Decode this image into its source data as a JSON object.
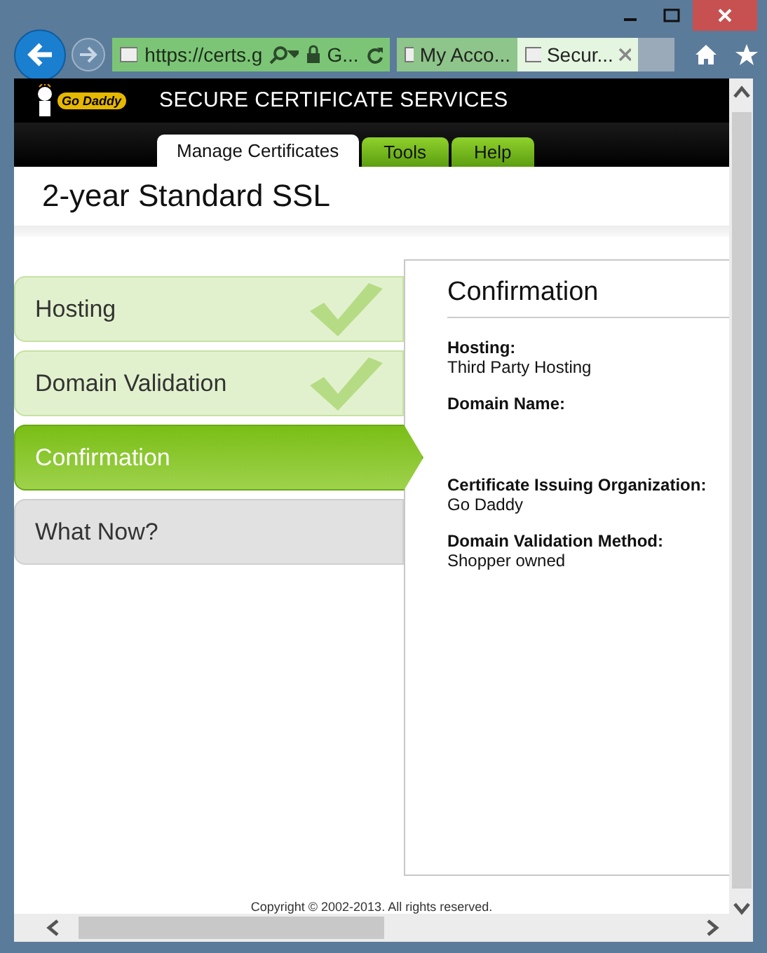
{
  "browser": {
    "address": {
      "url": "https://certs.g",
      "site": "G..."
    },
    "tabs": [
      {
        "label": "My Acco...",
        "selected": false
      },
      {
        "label": "Secur...",
        "selected": true
      }
    ]
  },
  "header": {
    "logo": "Go Daddy",
    "title": "SECURE CERTIFICATE SERVICES"
  },
  "nav_tabs": [
    {
      "label": "Manage Certificates",
      "selected": true
    },
    {
      "label": "Tools",
      "selected": false
    },
    {
      "label": "Help",
      "selected": false
    }
  ],
  "page_title": "2-year Standard SSL",
  "steps": [
    {
      "label": "Hosting",
      "completed": true,
      "selected": false
    },
    {
      "label": "Domain Validation",
      "completed": true,
      "selected": false
    },
    {
      "label": "Confirmation",
      "completed": false,
      "selected": true
    },
    {
      "label": "What Now?",
      "completed": false,
      "selected": false
    }
  ],
  "panel": {
    "title": "Confirmation",
    "fields": [
      {
        "label": "Hosting:",
        "value": "Third Party Hosting"
      },
      {
        "label": "Domain Name:"
      },
      {
        "label": "Certificate Issuing Organization:",
        "value": "Go Daddy"
      },
      {
        "label": "Domain Validation Method:",
        "value": "Shopper owned"
      }
    ]
  },
  "footer": "Copyright © 2002-2013. All rights reserved."
}
